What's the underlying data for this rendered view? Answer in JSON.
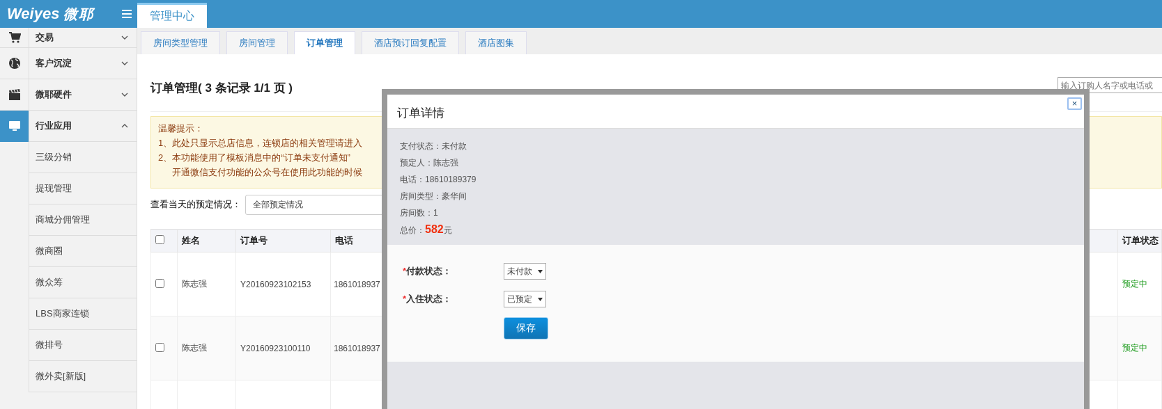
{
  "header": {
    "logo": "Weiyes",
    "logo_suffix": "微耶"
  },
  "top_tabs": [
    {
      "label": "管理中心",
      "selected": true
    }
  ],
  "sidebar": {
    "items": [
      {
        "label": "交易",
        "kind": "cart",
        "selected": false,
        "expanded": false
      },
      {
        "label": "客户沉淀",
        "kind": "globe",
        "selected": false,
        "expanded": false
      },
      {
        "label": "微耶硬件",
        "kind": "clapperboard",
        "selected": false,
        "expanded": false
      },
      {
        "label": "行业应用",
        "kind": "monitor",
        "selected": true,
        "expanded": true,
        "children": [
          {
            "label": "三级分销"
          },
          {
            "label": "提现管理"
          },
          {
            "label": "商城分佣管理"
          },
          {
            "label": "微商圈"
          },
          {
            "label": "微众筹"
          },
          {
            "label": "LBS商家连锁"
          },
          {
            "label": "微排号"
          },
          {
            "label": "微外卖[新版]"
          }
        ]
      }
    ]
  },
  "sub_tabs": [
    {
      "label": "房间类型管理",
      "selected": false
    },
    {
      "label": "房间管理",
      "selected": false
    },
    {
      "label": "订单管理",
      "selected": true
    },
    {
      "label": "酒店预订回复配置",
      "selected": false
    },
    {
      "label": "酒店图集",
      "selected": false
    }
  ],
  "page": {
    "title": "订单管理( 3 条记录 1/1 页 )",
    "search": {
      "placeholder": "输入订购人名字或电话或"
    }
  },
  "notice": {
    "title": "温馨提示：",
    "lines": [
      "1、此处只显示总店信息，连锁店的相关管理请进入",
      "2、本功能使用了模板消息中的“订单未支付通知”",
      "开通微信支付功能的公众号在使用此功能的时候"
    ]
  },
  "filter": {
    "label": "查看当天的预定情况：",
    "value": "全部预定情况"
  },
  "table": {
    "all_checked": false,
    "columns": [
      "姓名",
      "订单号",
      "电话",
      "订单状态"
    ],
    "rows": [
      {
        "checked": false,
        "name": "陈志强",
        "order_no": "Y20160923102153",
        "phone": "1861018937",
        "status": "预定中"
      },
      {
        "checked": false,
        "name": "陈志强",
        "order_no": "Y20160923100110",
        "phone": "1861018937",
        "status": "预定中"
      }
    ]
  },
  "modal": {
    "title": "订单详情",
    "close": "×",
    "info": [
      "支付状态：未付款",
      "预定人：陈志强",
      "电话：18610189379",
      "房间类型：豪华间",
      "房间数：1",
      "总价：**582**元"
    ],
    "fields": [
      {
        "required_mark": "*",
        "label": "付款状态：",
        "value": "未付款"
      },
      {
        "required_mark": "*",
        "label": "入住状态：",
        "value": "已预定"
      }
    ],
    "save_button": "保存"
  }
}
